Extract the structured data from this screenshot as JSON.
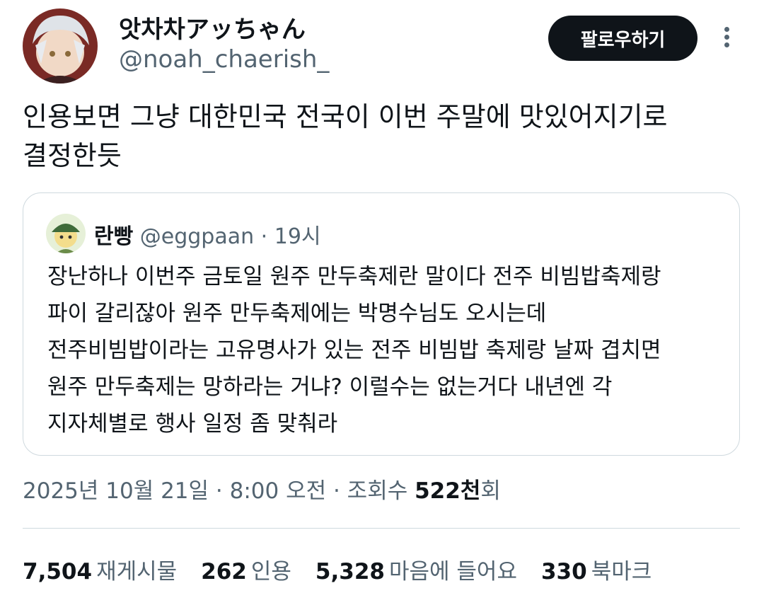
{
  "author": {
    "display_name": "앗차차アッちゃん",
    "handle": "@noah_chaerish_"
  },
  "follow_label": "팔로우하기",
  "tweet_lines": [
    "인용보면 그냥 대한민국 전국이 이번 주말에 맛있어지기로",
    "결정한듯"
  ],
  "quote": {
    "name": "란빵",
    "handle": "@eggpaan",
    "separator": "·",
    "time": "19시",
    "lines": [
      "장난하나 이번주 금토일 원주 만두축제란 말이다 전주 비빔밥축제랑",
      "파이 갈리잖아 원주 만두축제에는 박명수님도 오시는데",
      "전주비빔밥이라는 고유명사가 있는 전주 비빔밥 축제랑 날짜 겹치면",
      "원주 만두축제는 망하라는 거냐? 이럴수는 없는거다 내년엔 각",
      "지자체별로 행사 일정 좀 맞춰라"
    ]
  },
  "meta": {
    "date_time": "2025년 10월 21일 · 8:00 오전 · 조회수 ",
    "views_number": "522천",
    "views_suffix": "회"
  },
  "stats": {
    "retweets": "7,504",
    "retweets_label": "재게시물",
    "quotes": "262",
    "quotes_label": "인용",
    "likes": "5,328",
    "likes_label": "마음에 들어요",
    "bookmarks": "330",
    "bookmarks_label": "북마크"
  }
}
